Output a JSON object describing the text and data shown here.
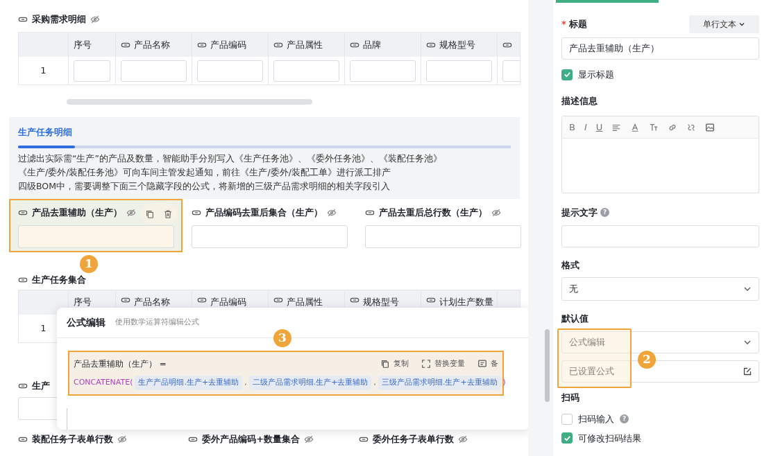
{
  "purchase_table": {
    "title": "采购需求明细",
    "hidden": true,
    "columns": [
      {
        "label": "序号",
        "linked": false
      },
      {
        "label": "产品名称",
        "linked": true
      },
      {
        "label": "产品编码",
        "linked": true
      },
      {
        "label": "产品属性",
        "linked": true
      },
      {
        "label": "品牌",
        "linked": true
      },
      {
        "label": "规格型号",
        "linked": true
      },
      {
        "linked": true
      }
    ],
    "rows": [
      {
        "index": "1"
      }
    ]
  },
  "info_banner": {
    "tab": "生产任务明细",
    "lines": [
      "过滤出实际需“生产”的产品及数量，智能助手分别写入《生产任务池》、《委外任务池》、《装配任务池》",
      "《生产/委外/装配任务池》可向车间主管发起通知，前往《生产/委外/装配工单》进行派工排产",
      "四级BOM中，需要调整下面三个隐藏字段的公式，将新增的三级产品需求明细的相关字段引入"
    ]
  },
  "fields": [
    {
      "label": "产品去重辅助（生产）",
      "hidden": true,
      "selected": true
    },
    {
      "label": "产品编码去重后集合（生产）",
      "hidden": true,
      "selected": false
    },
    {
      "label": "产品去重后总行数（生产）",
      "hidden": true,
      "selected": false
    }
  ],
  "callouts": [
    "1",
    "2",
    "3"
  ],
  "task_table": {
    "title": "生产任务集合",
    "hidden": false,
    "columns": [
      {
        "label": "序号",
        "linked": false
      },
      {
        "label": "产品名称",
        "linked": true
      },
      {
        "label": "产品编码",
        "linked": true
      },
      {
        "label": "产品属性",
        "linked": true
      },
      {
        "label": "规格型号",
        "linked": true
      },
      {
        "label": "计划生产数量",
        "linked": true
      }
    ],
    "rows": [
      {
        "index": "1"
      }
    ]
  },
  "partial_field": {
    "label": "生产"
  },
  "bottom_fields": [
    {
      "label": "装配任务子表单行数",
      "hidden": true
    },
    {
      "label": "委外产品编码+数量集合",
      "hidden": true
    },
    {
      "label": "委外任务子表单行数",
      "hidden": true
    }
  ],
  "formula_dialog": {
    "title": "公式编辑",
    "subtitle": "使用数学运算符编辑公式",
    "target": "产品去重辅助（生产） =",
    "actions": [
      {
        "kind": "copy",
        "label": "复制"
      },
      {
        "kind": "replace",
        "label": "替换变量"
      },
      {
        "kind": "note",
        "label": "备"
      }
    ],
    "formula": [
      {
        "kind": "func",
        "text": "CONCATENATE("
      },
      {
        "kind": "var",
        "text": "生产产品明细.生产+去重辅助"
      },
      {
        "kind": "sep",
        "text": ","
      },
      {
        "kind": "var",
        "text": "二级产品需求明细.生产+去重辅助"
      },
      {
        "kind": "sep",
        "text": ","
      },
      {
        "kind": "var",
        "text": "三级产品需求明细.生产+去重辅助"
      },
      {
        "kind": "func",
        "text": ")"
      }
    ]
  },
  "properties": {
    "title_label": "标题",
    "required_mark": "*",
    "type_button": "单行文本",
    "title_value": "产品去重辅助（生产）",
    "show_title": {
      "label": "显示标题",
      "checked": true
    },
    "description_label": "描述信息",
    "toolbar": [
      "B",
      "I",
      "U"
    ],
    "hint_label": "提示文字",
    "hint_help": "?",
    "format_label": "格式",
    "format_value": "无",
    "default_label": "默认值",
    "default_mode": "公式编辑",
    "default_value": "已设置公式",
    "scan_label": "扫码",
    "scan_options": [
      {
        "label": "扫码输入",
        "checked": false,
        "help": "?"
      },
      {
        "label": "可修改扫码结果",
        "checked": true
      }
    ]
  }
}
